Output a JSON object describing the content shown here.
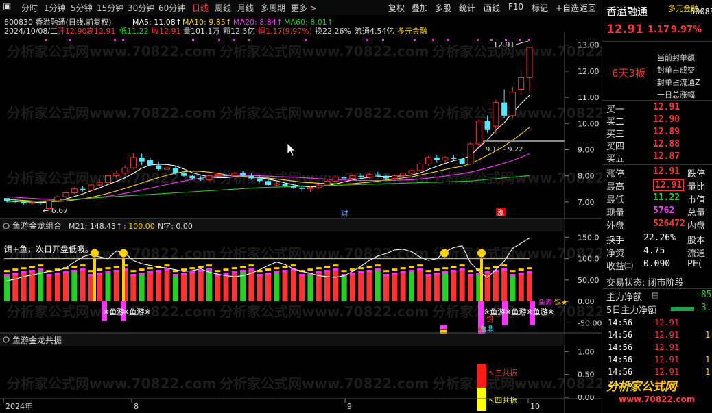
{
  "toolbar": {
    "periods": [
      {
        "label": "分时"
      },
      {
        "label": "1分钟"
      },
      {
        "label": "5分钟"
      },
      {
        "label": "15分钟"
      },
      {
        "label": "30分钟"
      },
      {
        "label": "60分钟"
      },
      {
        "label": "日线"
      },
      {
        "label": "周线"
      },
      {
        "label": "月线"
      },
      {
        "label": "多周期"
      },
      {
        "label": "更多 >"
      }
    ],
    "active_period": "日线",
    "tools": [
      {
        "label": "复权"
      },
      {
        "label": "叠加"
      },
      {
        "label": "多股"
      },
      {
        "label": "统计"
      },
      {
        "label": "画线"
      },
      {
        "label": "F10"
      },
      {
        "label": "标记"
      },
      {
        "label": "+自选"
      },
      {
        "label": "返回"
      }
    ]
  },
  "header": {
    "title": "600830 香溢融通(日线,前复权)",
    "ma_legend": [
      {
        "label": "MA5: 11.08↑",
        "color": "#ffffff"
      },
      {
        "label": "MA10: 9.85↑",
        "color": "#ffd700"
      },
      {
        "label": "MA20: 8.84↑",
        "color": "#ff33ff"
      },
      {
        "label": "MA60: 8.01↑",
        "color": "#22cc22"
      }
    ],
    "ohlc": {
      "date": "2024/10/08/二",
      "open": "开12.90",
      "high": "高12.91",
      "low": "低11.22",
      "close": "收12.91",
      "volume": "量101.1万",
      "amount": "额12.5亿",
      "pct": "幅1.17(9.97%)",
      "turnover": "换22.26%",
      "float": "流通4.54亿",
      "concept": "多元金融"
    }
  },
  "price_axis": [
    "13.00",
    "12.00",
    "11.00",
    "10.00",
    "9.00",
    "8.00",
    "7.00"
  ],
  "price_annotations": {
    "high": "12.91",
    "low": "6.67",
    "range": "9.11 - 9.22"
  },
  "event_markers": [
    "财",
    "涨"
  ],
  "watermark": "分析家公式网www.70822.com",
  "indicator1": {
    "title": "鱼游金龙组合",
    "m21": "M21: 148.43↑",
    "level": ": 100.00",
    "n_label": "N字: 0.00",
    "note": "饵+鱼，次日开盘低吸。",
    "axis": [
      "150.0",
      "100.0",
      "50.00",
      "0.00",
      "-50.00"
    ],
    "labels": [
      "※鱼游",
      "※鱼游※",
      "※鱼游※鱼游※鱼游※",
      "饵",
      "鲁鼎",
      "鱼游",
      "饵★"
    ]
  },
  "indicator2": {
    "title": "鱼游金龙共振",
    "axis": [
      "1.00",
      "0.50",
      "0.00"
    ],
    "labels": [
      "三共振",
      "四共振"
    ]
  },
  "xaxis": [
    "2024年",
    "8",
    "9",
    "10"
  ],
  "side": {
    "name": "香溢融通",
    "code": "60083",
    "concept": "多元金融",
    "price": "12.91",
    "change": "1.17",
    "pct": "9.97%",
    "board": "6天3板",
    "seal_labels": [
      "当前封单额",
      "封单占成交",
      "封单占流通Z",
      "十日总涨幅"
    ],
    "bids": [
      {
        "label": "买一",
        "price": "12.91"
      },
      {
        "label": "买二",
        "price": "12.90"
      },
      {
        "label": "买三",
        "price": "12.89"
      },
      {
        "label": "买四",
        "price": "12.88"
      },
      {
        "label": "买五",
        "price": "12.87"
      }
    ],
    "stats_left": [
      {
        "label": "涨停",
        "value": "12.91",
        "color": "red"
      },
      {
        "label": "最高",
        "value": "12.91",
        "color": "red"
      },
      {
        "label": "最低",
        "value": "11.22",
        "color": "grn"
      },
      {
        "label": "现量",
        "value": "5762",
        "color": "mag"
      },
      {
        "label": "外盘",
        "value": "526472",
        "color": "red"
      }
    ],
    "stats_right": [
      "跌停",
      "量比",
      "市值",
      "总量",
      "内盘"
    ],
    "stats2": [
      {
        "label": "换手",
        "value": "22.26%",
        "right": "股本"
      },
      {
        "label": "净资",
        "value": "4.75",
        "right": "流通"
      },
      {
        "label": "收益㈡",
        "value": "0.090",
        "right": "PE("
      }
    ],
    "status": "交易状态: 闭市阶段",
    "flow": [
      {
        "label": "主力净额",
        "value": "-85"
      },
      {
        "label": "5日主力净额",
        "value": "-3."
      }
    ],
    "ticks": [
      {
        "time": "14:56",
        "price": "12.91",
        "vol": ""
      },
      {
        "time": "14:56",
        "price": "12.91",
        "vol": "1"
      },
      {
        "time": "14:56",
        "price": "12.91",
        "vol": ""
      },
      {
        "time": "14:56",
        "price": "12.91",
        "vol": "1"
      },
      {
        "time": "14:56",
        "price": "12.91",
        "vol": "1"
      },
      {
        "time": "14:56",
        "price": "12.91",
        "vol": ""
      }
    ]
  },
  "logo": {
    "text": "分析家公式网",
    "url": "www.70822.com"
  },
  "chart_data": {
    "type": "candlestick",
    "title": "600830 香溢融通(日线,前复权)",
    "ylim": [
      6.5,
      13.2
    ],
    "y_ticks": [
      7,
      8,
      9,
      10,
      11,
      12,
      13
    ],
    "x_labels": [
      "2024年",
      "8",
      "9",
      "10"
    ],
    "candles": [
      [
        7.15,
        7.15,
        6.98,
        7.05
      ],
      [
        7.05,
        7.1,
        6.95,
        7.0
      ],
      [
        7.0,
        7.02,
        6.9,
        6.95
      ],
      [
        6.95,
        7.05,
        6.9,
        6.98
      ],
      [
        6.98,
        7.05,
        6.9,
        6.94
      ],
      [
        6.75,
        7.1,
        6.67,
        7.05
      ],
      [
        7.05,
        7.25,
        7.0,
        7.2
      ],
      [
        7.2,
        7.4,
        7.15,
        7.35
      ],
      [
        7.35,
        7.55,
        7.3,
        7.5
      ],
      [
        7.5,
        7.6,
        7.4,
        7.45
      ],
      [
        7.45,
        7.7,
        7.4,
        7.65
      ],
      [
        7.65,
        7.85,
        7.55,
        7.75
      ],
      [
        7.75,
        8.05,
        7.7,
        8.0
      ],
      [
        8.0,
        8.2,
        7.9,
        8.1
      ],
      [
        8.1,
        8.4,
        8.0,
        8.3
      ],
      [
        8.3,
        8.85,
        8.25,
        8.7
      ],
      [
        8.7,
        8.85,
        8.4,
        8.55
      ],
      [
        8.6,
        8.7,
        8.35,
        8.4
      ],
      [
        8.4,
        8.55,
        8.2,
        8.25
      ],
      [
        8.25,
        8.35,
        8.1,
        8.3
      ],
      [
        8.3,
        8.4,
        8.05,
        8.1
      ],
      [
        8.1,
        8.2,
        7.95,
        8.0
      ],
      [
        8.0,
        8.05,
        7.85,
        7.9
      ],
      [
        7.9,
        8.0,
        7.8,
        7.85
      ],
      [
        7.85,
        8.05,
        7.8,
        8.0
      ],
      [
        8.0,
        8.1,
        7.95,
        8.05
      ],
      [
        8.05,
        8.15,
        7.98,
        8.0
      ],
      [
        8.0,
        8.15,
        7.95,
        8.1
      ],
      [
        8.1,
        8.2,
        7.95,
        8.0
      ],
      [
        8.0,
        8.1,
        7.85,
        7.9
      ],
      [
        7.9,
        8.0,
        7.75,
        7.8
      ],
      [
        7.8,
        7.95,
        7.6,
        7.65
      ],
      [
        7.65,
        7.8,
        7.55,
        7.7
      ],
      [
        7.7,
        7.75,
        7.55,
        7.6
      ],
      [
        7.6,
        7.7,
        7.5,
        7.55
      ],
      [
        7.55,
        7.65,
        7.4,
        7.5
      ],
      [
        7.5,
        7.6,
        7.4,
        7.55
      ],
      [
        7.55,
        7.7,
        7.5,
        7.65
      ],
      [
        7.65,
        7.85,
        7.6,
        7.8
      ],
      [
        7.8,
        8.0,
        7.75,
        7.95
      ],
      [
        7.95,
        8.05,
        7.85,
        7.9
      ],
      [
        7.9,
        8.05,
        7.85,
        8.0
      ],
      [
        8.0,
        8.1,
        7.9,
        7.95
      ],
      [
        7.95,
        8.1,
        7.9,
        8.05
      ],
      [
        8.05,
        8.15,
        7.95,
        8.0
      ],
      [
        8.0,
        8.05,
        7.85,
        7.9
      ],
      [
        7.9,
        8.05,
        7.85,
        8.0
      ],
      [
        8.0,
        8.15,
        7.95,
        8.1
      ],
      [
        8.1,
        8.25,
        8.05,
        8.2
      ],
      [
        8.2,
        8.5,
        8.15,
        8.45
      ],
      [
        8.45,
        8.75,
        8.4,
        8.7
      ],
      [
        8.7,
        8.8,
        8.5,
        8.6
      ],
      [
        8.6,
        8.75,
        8.5,
        8.7
      ],
      [
        8.7,
        8.8,
        8.6,
        8.65
      ],
      [
        8.65,
        8.7,
        8.4,
        8.45
      ],
      [
        8.45,
        9.3,
        8.4,
        9.22
      ],
      [
        9.22,
        10.15,
        9.11,
        10.1
      ],
      [
        10.1,
        10.3,
        9.65,
        9.75
      ],
      [
        9.9,
        10.9,
        9.6,
        10.8
      ],
      [
        10.8,
        11.3,
        10.2,
        10.3
      ],
      [
        10.3,
        11.4,
        10.2,
        11.2
      ],
      [
        11.3,
        12.05,
        11.1,
        11.75
      ],
      [
        11.75,
        12.1,
        11.22,
        12.91
      ]
    ],
    "ma": [
      {
        "name": "MA5",
        "color": "#ffffff",
        "values": [
          7.05,
          7.03,
          7.01,
          6.99,
          6.98,
          6.99,
          7.05,
          7.12,
          7.21,
          7.31,
          7.43,
          7.54,
          7.67,
          7.79,
          7.92,
          8.1,
          8.29,
          8.41,
          8.44,
          8.43,
          8.38,
          8.26,
          8.12,
          8.03,
          7.96,
          7.93,
          7.93,
          7.96,
          7.97,
          7.96,
          7.93,
          7.87,
          7.81,
          7.73,
          7.66,
          7.6,
          7.58,
          7.59,
          7.63,
          7.69,
          7.77,
          7.84,
          7.9,
          7.94,
          7.97,
          7.98,
          7.98,
          8.0,
          8.03,
          8.11,
          8.24,
          8.36,
          8.47,
          8.58,
          8.64,
          8.77,
          9.1,
          9.37,
          9.74,
          10.03,
          10.42,
          10.76,
          11.08
        ]
      },
      {
        "name": "MA10",
        "color": "#ffd700",
        "values": [
          7.1,
          7.08,
          7.06,
          7.04,
          7.02,
          7.01,
          7.02,
          7.04,
          7.08,
          7.12,
          7.18,
          7.25,
          7.33,
          7.42,
          7.52,
          7.62,
          7.73,
          7.83,
          7.93,
          8.02,
          8.1,
          8.16,
          8.18,
          8.17,
          8.14,
          8.1,
          8.04,
          7.98,
          7.96,
          7.94,
          7.93,
          7.91,
          7.88,
          7.84,
          7.8,
          7.76,
          7.74,
          7.72,
          7.71,
          7.7,
          7.69,
          7.7,
          7.73,
          7.76,
          7.8,
          7.84,
          7.88,
          7.92,
          7.96,
          8.03,
          8.1,
          8.17,
          8.24,
          8.31,
          8.36,
          8.46,
          8.62,
          8.78,
          8.95,
          9.14,
          9.36,
          9.6,
          9.85
        ]
      },
      {
        "name": "MA20",
        "color": "#ff33ff",
        "values": [
          7.2,
          7.18,
          7.16,
          7.14,
          7.12,
          7.1,
          7.09,
          7.09,
          7.1,
          7.12,
          7.15,
          7.18,
          7.22,
          7.27,
          7.33,
          7.39,
          7.46,
          7.53,
          7.6,
          7.67,
          7.74,
          7.8,
          7.86,
          7.91,
          7.95,
          7.98,
          8.0,
          8.01,
          8.01,
          8.01,
          8.0,
          7.99,
          7.97,
          7.96,
          7.95,
          7.93,
          7.91,
          7.89,
          7.87,
          7.85,
          7.84,
          7.83,
          7.82,
          7.82,
          7.82,
          7.82,
          7.83,
          7.84,
          7.85,
          7.88,
          7.91,
          7.95,
          7.99,
          8.04,
          8.08,
          8.14,
          8.22,
          8.3,
          8.39,
          8.48,
          8.59,
          8.71,
          8.84
        ]
      },
      {
        "name": "MA60",
        "color": "#22cc22",
        "values": [
          7.0,
          7.01,
          7.02,
          7.03,
          7.04,
          7.05,
          7.07,
          7.09,
          7.11,
          7.13,
          7.15,
          7.17,
          7.19,
          7.21,
          7.23,
          7.25,
          7.27,
          7.29,
          7.31,
          7.33,
          7.35,
          7.37,
          7.39,
          7.41,
          7.43,
          7.45,
          7.47,
          7.49,
          7.51,
          7.53,
          7.55,
          7.56,
          7.57,
          7.58,
          7.59,
          7.6,
          7.61,
          7.62,
          7.63,
          7.64,
          7.65,
          7.66,
          7.67,
          7.68,
          7.69,
          7.7,
          7.71,
          7.72,
          7.73,
          7.74,
          7.75,
          7.76,
          7.77,
          7.78,
          7.79,
          7.8,
          7.83,
          7.86,
          7.89,
          7.92,
          7.95,
          7.98,
          8.01
        ]
      }
    ],
    "indicator_line": [
      48,
      52,
      58,
      62,
      66,
      70,
      72,
      78,
      92,
      104,
      110,
      104,
      100,
      118,
      112,
      96,
      88,
      84,
      80,
      78,
      74,
      70,
      72,
      76,
      68,
      64,
      60,
      58,
      60,
      66,
      74,
      84,
      92,
      86,
      76,
      70,
      66,
      60,
      58,
      56,
      60,
      70,
      82,
      96,
      106,
      112,
      120,
      122,
      116,
      104,
      96,
      100,
      116,
      126,
      130,
      90,
      70,
      56,
      74,
      94,
      124,
      136,
      148
    ]
  }
}
